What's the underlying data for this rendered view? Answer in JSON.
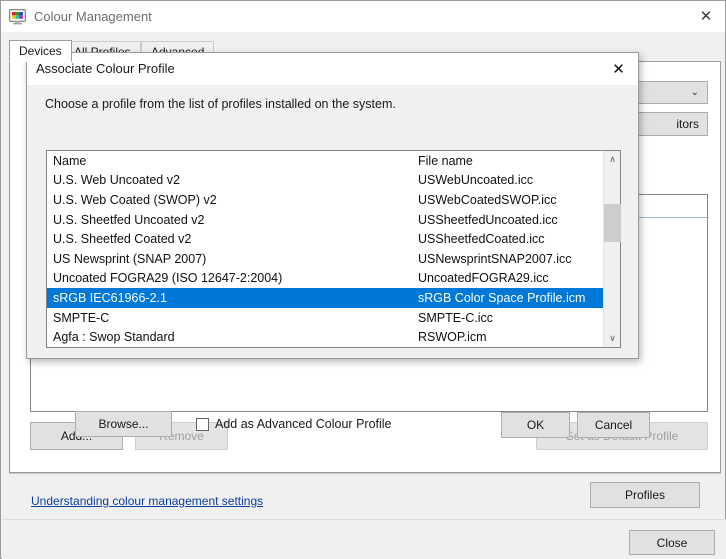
{
  "main_window": {
    "title": "Colour Management",
    "icon": "monitor-colour-icon",
    "close_label": "✕",
    "tabs": [
      {
        "label": "Devices",
        "active": true
      },
      {
        "label": "All Profiles",
        "active": false
      },
      {
        "label": "Advanced",
        "active": false
      }
    ],
    "identify_button": "itors",
    "combo_chevron": "⌄",
    "buttons": {
      "add": "Add...",
      "remove": "Remove",
      "set_default": "Set as Default Profile",
      "profiles": "Profiles",
      "close": "Close"
    },
    "help_link": "Understanding colour management settings"
  },
  "dialog": {
    "title": "Associate Colour Profile",
    "close_label": "✕",
    "prompt": "Choose a profile from the list of profiles installed on the system.",
    "columns": {
      "name": "Name",
      "file_name": "File name"
    },
    "rows": [
      {
        "name": "U.S. Web Uncoated v2",
        "file": "USWebUncoated.icc",
        "selected": false
      },
      {
        "name": "U.S. Web Coated (SWOP) v2",
        "file": "USWebCoatedSWOP.icc",
        "selected": false
      },
      {
        "name": "U.S. Sheetfed Uncoated v2",
        "file": "USSheetfedUncoated.icc",
        "selected": false
      },
      {
        "name": "U.S. Sheetfed Coated v2",
        "file": "USSheetfedCoated.icc",
        "selected": false
      },
      {
        "name": "US Newsprint (SNAP 2007)",
        "file": "USNewsprintSNAP2007.icc",
        "selected": false
      },
      {
        "name": "Uncoated FOGRA29 (ISO 12647-2:2004)",
        "file": "UncoatedFOGRA29.icc",
        "selected": false
      },
      {
        "name": "sRGB IEC61966-2.1",
        "file": "sRGB Color Space Profile.icm",
        "selected": true
      },
      {
        "name": "SMPTE-C",
        "file": "SMPTE-C.icc",
        "selected": false
      },
      {
        "name": "Agfa : Swop Standard",
        "file": "RSWOP.icm",
        "selected": false
      }
    ],
    "scrollbar": {
      "up": "∧",
      "down": "∨"
    },
    "browse_button": "Browse...",
    "checkbox_label": "Add as Advanced Colour Profile",
    "checkbox_checked": false,
    "ok_button": "OK",
    "cancel_button": "Cancel"
  },
  "colors": {
    "selection_blue": "#0078d7",
    "window_chrome": "#f0f0f0",
    "link_blue": "#0b3fa0",
    "button_face": "#e1e1e1"
  }
}
